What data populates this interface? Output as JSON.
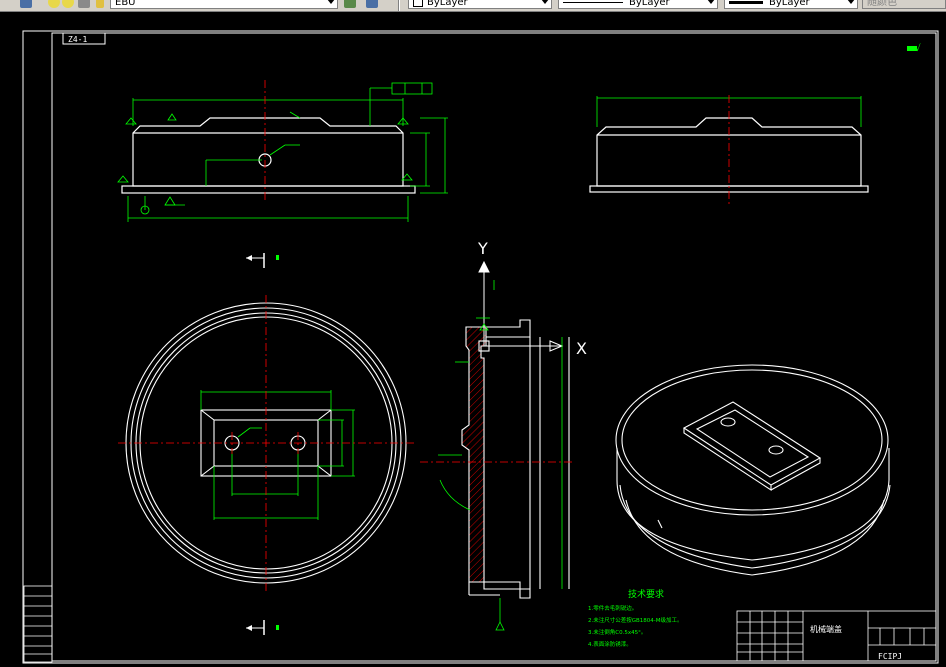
{
  "toolbar": {
    "layer_name": "EBU",
    "color_value": "ByLayer",
    "linetype_value": "ByLayer",
    "lineweight_value": "ByLayer",
    "plotstyle_value": "随颜色"
  },
  "drawing": {
    "top_label": "Z4-1",
    "corner_label": "√",
    "axis_y": "Y",
    "axis_x": "X",
    "tech_req_title": "技术要求",
    "tech_req_items": [
      "1.零件去毛刺锐边。",
      "2.未注尺寸公差按GB1804-M级加工。",
      "3.未注倒角C0.5x45°。",
      "4.表面涂防锈漆。"
    ],
    "title_block_name": "机械端盖",
    "title_block_code": "FCIPJ"
  },
  "colors": {
    "background": "#000000",
    "geometry": "#ffffff",
    "dimension": "#00ff00",
    "centerline": "#ff0000",
    "toolbar": "#d4d0c8"
  }
}
